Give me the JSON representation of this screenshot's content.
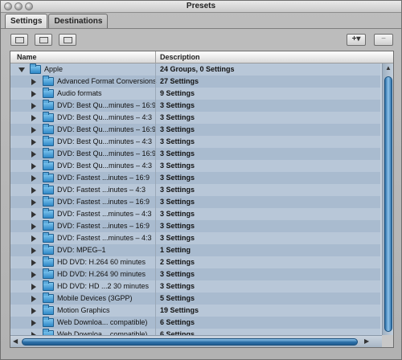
{
  "window": {
    "title": "Presets"
  },
  "tabs": [
    {
      "label": "Settings",
      "active": true
    },
    {
      "label": "Destinations",
      "active": false
    }
  ],
  "toolbar": {
    "new_folder_icon": "new-folder-icon",
    "duplicate_icon": "duplicate-icon",
    "copy_icon": "copy-icon",
    "add_label": "+▾",
    "remove_label": "−"
  },
  "table": {
    "headers": {
      "name": "Name",
      "description": "Description"
    },
    "rows": [
      {
        "name": "Apple",
        "description": "24 Groups, 0 Settings",
        "level": 0,
        "expanded": true
      },
      {
        "name": "Advanced Format Conversions",
        "description": "27 Settings",
        "level": 1
      },
      {
        "name": "Audio formats",
        "description": "9 Settings",
        "level": 1
      },
      {
        "name": "DVD: Best Qu...minutes – 16:9",
        "description": "3 Settings",
        "level": 1
      },
      {
        "name": "DVD: Best Qu...minutes – 4:3",
        "description": "3 Settings",
        "level": 1
      },
      {
        "name": "DVD: Best Qu...minutes – 16:9",
        "description": "3 Settings",
        "level": 1
      },
      {
        "name": "DVD: Best Qu...minutes – 4:3",
        "description": "3 Settings",
        "level": 1
      },
      {
        "name": "DVD: Best Qu...minutes – 16:9",
        "description": "3 Settings",
        "level": 1
      },
      {
        "name": "DVD: Best Qu...minutes – 4:3",
        "description": "3 Settings",
        "level": 1
      },
      {
        "name": "DVD: Fastest ...inutes – 16:9",
        "description": "3 Settings",
        "level": 1
      },
      {
        "name": "DVD: Fastest ...inutes – 4:3",
        "description": "3 Settings",
        "level": 1
      },
      {
        "name": "DVD: Fastest ...inutes – 16:9",
        "description": "3 Settings",
        "level": 1
      },
      {
        "name": "DVD: Fastest ...minutes – 4:3",
        "description": "3 Settings",
        "level": 1
      },
      {
        "name": "DVD: Fastest ...inutes – 16:9",
        "description": "3 Settings",
        "level": 1
      },
      {
        "name": "DVD: Fastest ...minutes – 4:3",
        "description": "3 Settings",
        "level": 1
      },
      {
        "name": "DVD: MPEG–1",
        "description": "1 Setting",
        "level": 1
      },
      {
        "name": "HD DVD: H.264 60 minutes",
        "description": "2 Settings",
        "level": 1
      },
      {
        "name": "HD DVD: H.264 90 minutes",
        "description": "3 Settings",
        "level": 1
      },
      {
        "name": "HD DVD: HD ...2 30 minutes",
        "description": "3 Settings",
        "level": 1
      },
      {
        "name": "Mobile Devices (3GPP)",
        "description": "5 Settings",
        "level": 1
      },
      {
        "name": "Motion Graphics",
        "description": "19 Settings",
        "level": 1
      },
      {
        "name": "Web Downloa... compatible)",
        "description": "6 Settings",
        "level": 1
      },
      {
        "name": "Web Downloa... compatible)",
        "description": "6 Settings",
        "level": 1
      }
    ]
  }
}
